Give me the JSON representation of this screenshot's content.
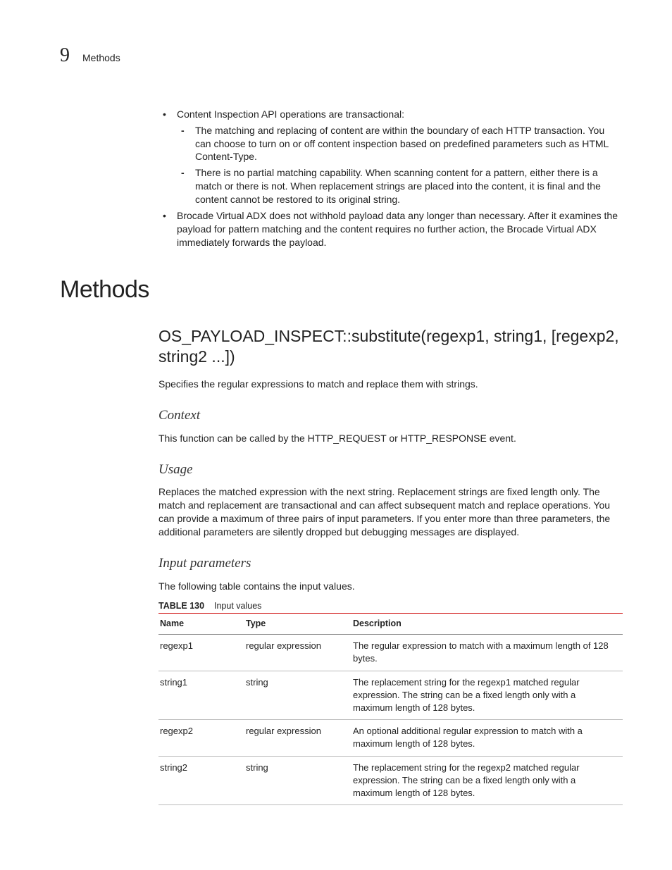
{
  "header": {
    "chapter_number": "9",
    "chapter_label": "Methods"
  },
  "bullets": {
    "b1": "Content Inspection API operations are transactional:",
    "b1a": "The matching and replacing of content are within the boundary of each HTTP transaction. You can choose to turn on or off content inspection based on predefined parameters such as HTML Content-Type.",
    "b1b": "There is no partial matching capability. When scanning content for a pattern, either there is a match or there is not. When replacement strings are placed into the content, it is final and the content cannot be restored to its original string.",
    "b2": "Brocade Virtual ADX does not withhold payload data any longer than necessary. After it examines the payload for pattern matching and the content requires no further action, the Brocade Virtual ADX immediately forwards the payload."
  },
  "section_title": "Methods",
  "method": {
    "title": "OS_PAYLOAD_INSPECT::substitute(regexp1, string1, [regexp2, string2 ...])",
    "desc": "Specifies the regular expressions to match and replace them with strings.",
    "context_h": "Context",
    "context_p": "This function can be called by the HTTP_REQUEST or HTTP_RESPONSE event.",
    "usage_h": "Usage",
    "usage_p": "Replaces the matched expression with the next string. Replacement strings are fixed length only. The match and replacement are transactional and can affect subsequent match and replace operations. You can provide a maximum of three pairs of input parameters. If you enter more than three parameters, the additional parameters are silently dropped but debugging messages are displayed.",
    "input_h": "Input parameters",
    "input_p": "The following table contains the input values."
  },
  "table": {
    "caption_label": "TABLE 130",
    "caption_title": "Input values",
    "head": {
      "c1": "Name",
      "c2": "Type",
      "c3": "Description"
    },
    "rows": [
      {
        "c1": "regexp1",
        "c2": "regular expression",
        "c3": "The regular expression to match with a maximum length of 128 bytes."
      },
      {
        "c1": "string1",
        "c2": "string",
        "c3": "The replacement string for the regexp1 matched regular expression. The string can be a fixed length only with a maximum length of 128 bytes."
      },
      {
        "c1": "regexp2",
        "c2": "regular expression",
        "c3": "An optional additional regular expression to match with a maximum length of 128 bytes."
      },
      {
        "c1": "string2",
        "c2": "string",
        "c3": "The replacement string for the regexp2 matched regular expression. The string can be a fixed length only with a maximum length of 128 bytes."
      }
    ]
  }
}
